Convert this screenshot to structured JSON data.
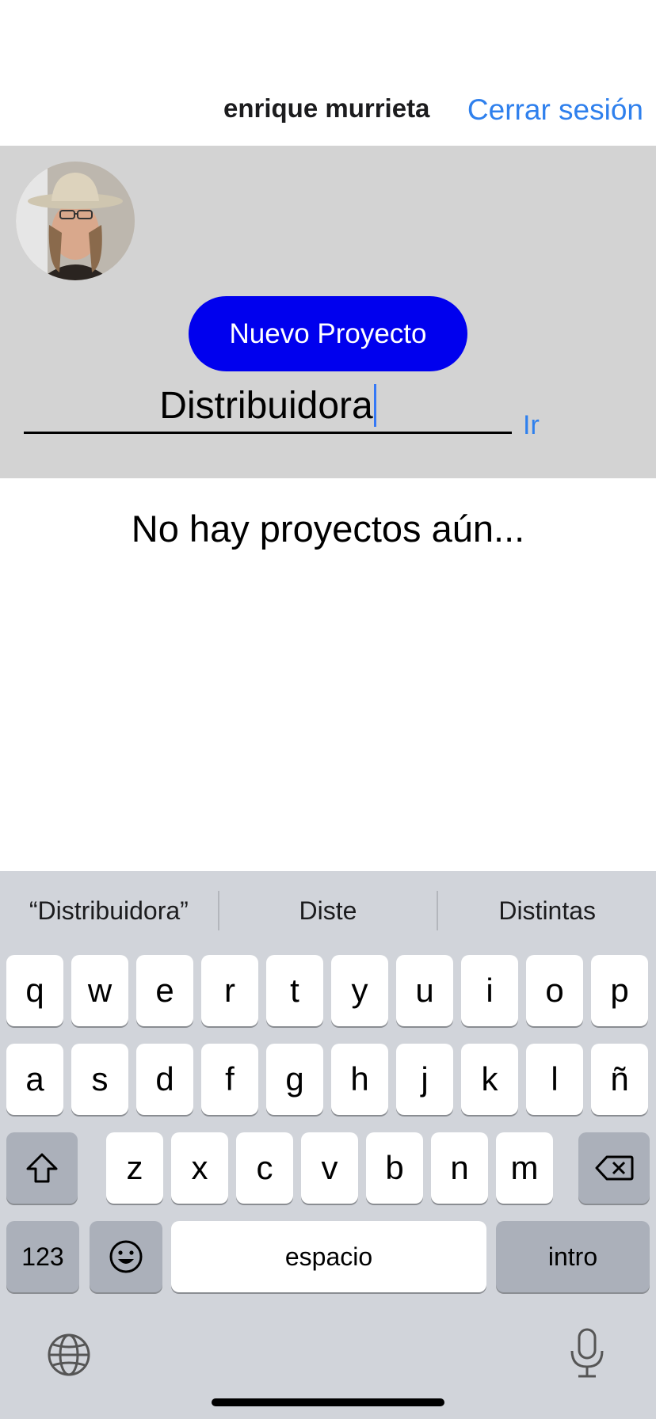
{
  "header": {
    "user_name": "enrique murrieta",
    "logout_label": "Cerrar sesión"
  },
  "profile": {
    "new_project_label": "Nuevo Proyecto",
    "search_value": "Distribuidora",
    "go_label": "Ir"
  },
  "main": {
    "empty_message": "No hay proyectos aún..."
  },
  "keyboard": {
    "suggestions": [
      "“Distribuidora”",
      "Diste",
      "Distintas"
    ],
    "row1": [
      "q",
      "w",
      "e",
      "r",
      "t",
      "y",
      "u",
      "i",
      "o",
      "p"
    ],
    "row2": [
      "a",
      "s",
      "d",
      "f",
      "g",
      "h",
      "j",
      "k",
      "l",
      "ñ"
    ],
    "row3": [
      "z",
      "x",
      "c",
      "v",
      "b",
      "n",
      "m"
    ],
    "numbers_label": "123",
    "space_label": "espacio",
    "return_label": "intro",
    "icons": {
      "shift": "shift-icon",
      "delete": "backspace-icon",
      "emoji": "emoji-icon",
      "globe": "globe-icon",
      "mic": "microphone-icon"
    }
  },
  "colors": {
    "accent": "#2f80ed",
    "button_blue": "#0000ee",
    "header_gray": "#d3d3d3",
    "keyboard_bg": "#d1d4da"
  }
}
